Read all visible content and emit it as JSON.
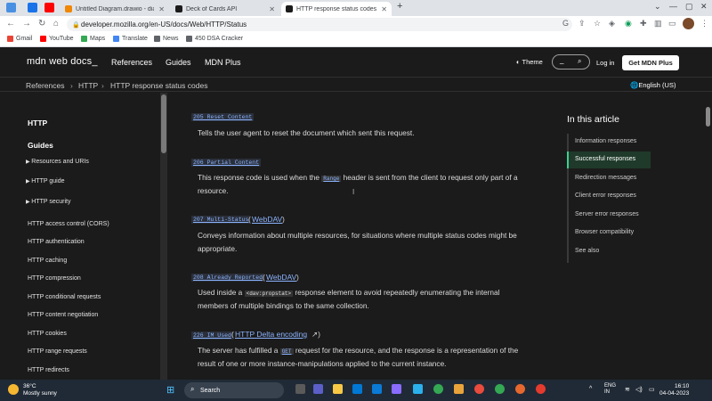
{
  "browser": {
    "tabs": [
      {
        "title": "Untitled Diagram.drawio - diagr",
        "favicon_color": "#f08705",
        "active": false
      },
      {
        "title": "Deck of Cards API",
        "favicon_color": "#1b1b1b",
        "active": false
      },
      {
        "title": "HTTP response status codes - H",
        "favicon_color": "#1b1b1b",
        "active": true
      }
    ],
    "new_tab": "+",
    "url": "developer.mozilla.org/en-US/docs/Web/HTTP/Status",
    "bookmarks": [
      {
        "label": "Gmail",
        "color": "#ea4335"
      },
      {
        "label": "YouTube",
        "color": "#ff0000"
      },
      {
        "label": "Maps",
        "color": "#34a853"
      },
      {
        "label": "Translate",
        "color": "#4285f4"
      },
      {
        "label": "News",
        "color": "#5f6368"
      },
      {
        "label": "450 DSA Cracker",
        "color": "#5f6368"
      }
    ]
  },
  "mdn": {
    "logo": "mdn web docs_",
    "nav": [
      "References",
      "Guides",
      "MDN Plus"
    ],
    "theme": "Theme",
    "search_placeholder": "_",
    "login": "Log in",
    "get_plus": "Get MDN Plus",
    "breadcrumbs": [
      "References",
      "HTTP",
      "HTTP response status codes"
    ],
    "language": "English (US)"
  },
  "sidebar": {
    "section": "HTTP",
    "guides_heading": "Guides",
    "collapsibles": [
      "Resources and URIs",
      "HTTP guide",
      "HTTP security"
    ],
    "items": [
      "HTTP access control (CORS)",
      "HTTP authentication",
      "HTTP caching",
      "HTTP compression",
      "HTTP conditional requests",
      "HTTP content negotiation",
      "HTTP cookies",
      "HTTP range requests",
      "HTTP redirects"
    ]
  },
  "content": {
    "entries": [
      {
        "code": "205 Reset Content",
        "extra": "",
        "lines": [
          "Tells the user agent to reset the document which sent this request."
        ]
      },
      {
        "code": "206 Partial Content",
        "extra": "",
        "line1_pre": "This response code is used when the",
        "line1_code": "Range",
        "line1_post": "header is sent from the client to request only part of a",
        "line2": "resource."
      },
      {
        "code": "207 Multi-Status",
        "extra": "WebDAV",
        "lines": [
          "Conveys information about multiple resources, for situations where multiple status codes might be",
          "appropriate."
        ]
      },
      {
        "code": "208 Already Reported",
        "extra": "WebDAV",
        "line1_pre": "Used inside a",
        "line1_code": "<dav:propstat>",
        "line1_post": "response element to avoid repeatedly enumerating the internal",
        "line2": "members of multiple bindings to the same collection."
      },
      {
        "code": "226 IM Used",
        "extra": "HTTP Delta encoding",
        "line1_pre": "The server has fulfilled a",
        "line1_code": "GET",
        "line1_post": "request for the resource, and the response is a representation of the",
        "line2": "result of one or more instance-manipulations applied to the current instance."
      }
    ]
  },
  "toc": {
    "title": "In this article",
    "items": [
      "Information responses",
      "Successful responses",
      "Redirection messages",
      "Client error responses",
      "Server error responses",
      "Browser compatibility",
      "See also"
    ],
    "active_index": 1,
    "active_color": "#3fcf8e"
  },
  "taskbar": {
    "temp": "36°C",
    "weather": "Mostly sunny",
    "search": "Search",
    "lang1": "ENG",
    "lang2": "IN",
    "time": "16:10",
    "date": "04-04-2023"
  }
}
